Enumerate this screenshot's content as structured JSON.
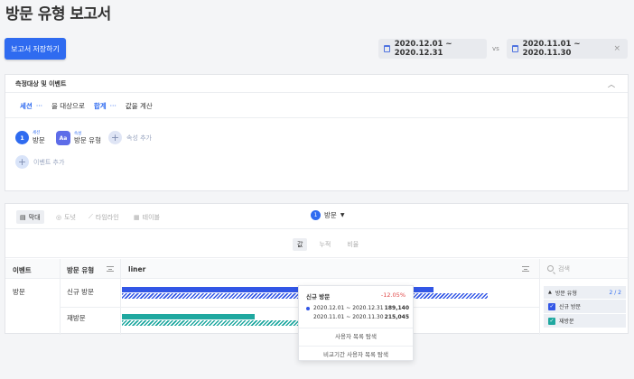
{
  "page": {
    "title": "방문 유형 보고서"
  },
  "toolbar": {
    "save_label": "보고서 저장하기",
    "date_range": "2020.12.01 ~ 2020.12.31",
    "vs_label": "vs",
    "compare_range": "2020.11.01 ~ 2020.11.30",
    "clear_icon": "×"
  },
  "measure_panel": {
    "header": "측정대상 및 이벤트",
    "sentence": {
      "target_label": "세션",
      "target_dots": "···",
      "target_suffix": "을 대상으로",
      "agg_label": "합계",
      "agg_dots": "···",
      "agg_suffix": "값을 계산"
    },
    "event_chip": {
      "index": "1",
      "sublabel": "세션",
      "label": "방문"
    },
    "attribute_chip": {
      "icon_text": "Aa",
      "sublabel": "속성",
      "label": "방문 유형"
    },
    "add_attribute_label": "속성 추가",
    "add_event_label": "이벤트 추가"
  },
  "report": {
    "view_tabs": [
      {
        "label": "막대",
        "icon": "bar-icon",
        "active": true
      },
      {
        "label": "도넛",
        "icon": "donut-icon",
        "active": false
      },
      {
        "label": "타임라인",
        "icon": "timeline-icon",
        "active": false
      },
      {
        "label": "테이블",
        "icon": "table-icon",
        "active": false
      }
    ],
    "metric_selector": {
      "index": "1",
      "label": "방문"
    },
    "value_tabs": [
      {
        "label": "값",
        "active": true
      },
      {
        "label": "누적",
        "active": false
      },
      {
        "label": "비율",
        "active": false
      }
    ],
    "columns": {
      "event": "이벤트",
      "visit_type": "방문 유형",
      "chart": "liner"
    },
    "rows": [
      {
        "event": "방문",
        "type": "신규 방문",
        "current_ratio": 0.75,
        "compare_ratio": 0.88
      },
      {
        "event": "",
        "type": "재방문",
        "current_ratio": 0.32,
        "compare_ratio": 0.43
      }
    ],
    "colors": {
      "new_visit": "#3357e6",
      "revisit": "#1fa8a0"
    },
    "legend": {
      "search_placeholder": "검색",
      "group_label": "방문 유형",
      "count": "2 / 2",
      "items": [
        {
          "label": "신규 방문",
          "color": "#3357e6"
        },
        {
          "label": "재방문",
          "color": "#1fa8a0"
        }
      ]
    },
    "tooltip": {
      "title": "신규 방문",
      "change": "-12.05%",
      "current_range": "2020.12.01 ~ 2020.12.31",
      "current_value": "189,140",
      "compare_range": "2020.11.01 ~ 2020.11.30",
      "compare_value": "215,045",
      "link_users": "사용자 목록 탐색",
      "link_compare_users": "비교기간 사용자 목록 탐색"
    }
  }
}
